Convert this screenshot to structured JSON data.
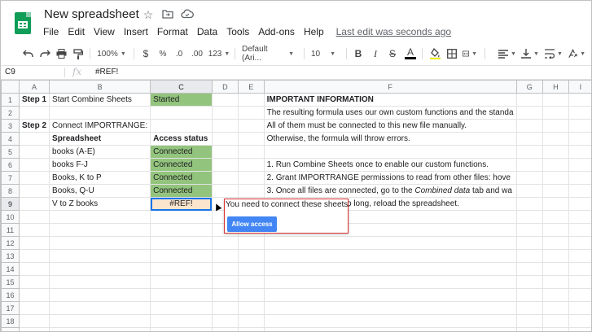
{
  "app": {
    "doc_title": "New spreadsheet",
    "menu": [
      "File",
      "Edit",
      "View",
      "Insert",
      "Format",
      "Data",
      "Tools",
      "Add-ons",
      "Help"
    ],
    "last_edit": "Last edit was seconds ago"
  },
  "toolbar": {
    "zoom": "100%",
    "currency": "$",
    "percent": "%",
    "dec_less": ".0",
    "dec_more": ".00",
    "more_formats": "123",
    "font": "Default (Ari...",
    "font_size": "10",
    "bold": "B",
    "italic": "I",
    "strike": "S",
    "text_color": "A"
  },
  "formula_bar": {
    "cell_ref": "C9",
    "fx": "fx",
    "value": "#REF!"
  },
  "columns": [
    "A",
    "B",
    "C",
    "D",
    "E",
    "F",
    "G",
    "H",
    "I"
  ],
  "selected_column": "C",
  "rows": [
    {
      "num": "1",
      "A": "Step 1",
      "B": "Start Combine Sheets",
      "C": "Started",
      "F": "IMPORTANT INFORMATION"
    },
    {
      "num": "2",
      "A": "",
      "B": "",
      "C": "",
      "F": "The resulting formula uses our own custom functions and the standa"
    },
    {
      "num": "3",
      "A": "Step 2",
      "B": "Connect IMPORTRANGE:",
      "C": "",
      "F": "All of them must be connected to this new file manually."
    },
    {
      "num": "4",
      "A": "",
      "B": "Spreadsheet",
      "C": "Access status",
      "F": "Otherwise, the formula will throw errors."
    },
    {
      "num": "5",
      "A": "",
      "B": "books (A-E)",
      "C": "Connected",
      "F": ""
    },
    {
      "num": "6",
      "A": "",
      "B": "books F-J",
      "C": "Connected",
      "F": "1. Run Combine Sheets once to enable our custom functions."
    },
    {
      "num": "7",
      "A": "",
      "B": "Books, K to P",
      "C": "Connected",
      "F": "2. Grant IMPORTRANGE permissions to read from other files: hove"
    },
    {
      "num": "8",
      "A": "",
      "B": "Books, Q-U",
      "C": "Connected",
      "F": "3. Once all files are connected, go to the Combined data tab and wa"
    },
    {
      "num": "9",
      "A": "",
      "B": "V to Z books",
      "C": "#REF!",
      "F": "4. If the result loads too long, reload the spreadsheet."
    },
    {
      "num": "10"
    },
    {
      "num": "11"
    },
    {
      "num": "12"
    },
    {
      "num": "13"
    },
    {
      "num": "14"
    },
    {
      "num": "15"
    },
    {
      "num": "16"
    },
    {
      "num": "17"
    },
    {
      "num": "18"
    },
    {
      "num": "19"
    }
  ],
  "row8_parts": {
    "pre": "3. Once all files are connected, go to the ",
    "em": "Combined data",
    "post": " tab and wa"
  },
  "tooltip": {
    "message": "You need to connect these sheets.",
    "button": "Allow access"
  },
  "colors": {
    "green": "#93c47d",
    "ref_fill": "#fce5cd",
    "selection": "#1a73e8",
    "button": "#4285f4",
    "logo": "#0f9d58"
  }
}
